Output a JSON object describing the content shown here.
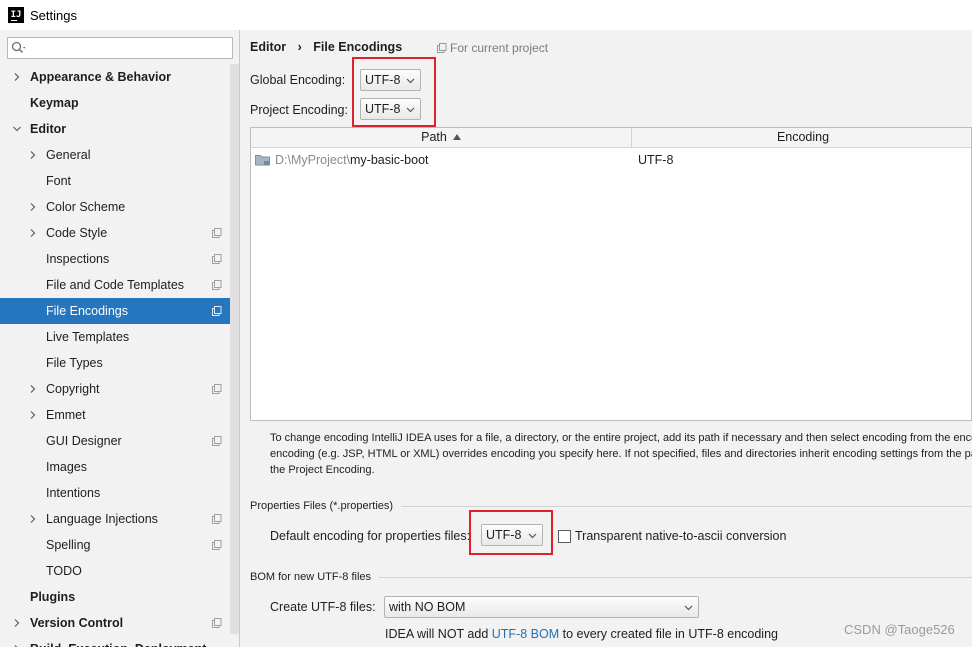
{
  "window": {
    "title": "Settings",
    "logo_text": "IJ"
  },
  "search": {
    "placeholder": ""
  },
  "sidebar": {
    "items": [
      {
        "label": "Appearance & Behavior",
        "level": 0,
        "bold": true,
        "expandable": true,
        "expanded": false,
        "project_icon": false,
        "selected": false
      },
      {
        "label": "Keymap",
        "level": 0,
        "bold": true,
        "expandable": false,
        "expanded": false,
        "project_icon": false,
        "selected": false
      },
      {
        "label": "Editor",
        "level": 0,
        "bold": true,
        "expandable": true,
        "expanded": true,
        "project_icon": false,
        "selected": false
      },
      {
        "label": "General",
        "level": 1,
        "bold": false,
        "expandable": true,
        "expanded": false,
        "project_icon": false,
        "selected": false
      },
      {
        "label": "Font",
        "level": 1,
        "bold": false,
        "expandable": false,
        "expanded": false,
        "project_icon": false,
        "selected": false
      },
      {
        "label": "Color Scheme",
        "level": 1,
        "bold": false,
        "expandable": true,
        "expanded": false,
        "project_icon": false,
        "selected": false
      },
      {
        "label": "Code Style",
        "level": 1,
        "bold": false,
        "expandable": true,
        "expanded": false,
        "project_icon": true,
        "selected": false
      },
      {
        "label": "Inspections",
        "level": 1,
        "bold": false,
        "expandable": false,
        "expanded": false,
        "project_icon": true,
        "selected": false
      },
      {
        "label": "File and Code Templates",
        "level": 1,
        "bold": false,
        "expandable": false,
        "expanded": false,
        "project_icon": true,
        "selected": false
      },
      {
        "label": "File Encodings",
        "level": 1,
        "bold": false,
        "expandable": false,
        "expanded": false,
        "project_icon": true,
        "selected": true
      },
      {
        "label": "Live Templates",
        "level": 1,
        "bold": false,
        "expandable": false,
        "expanded": false,
        "project_icon": false,
        "selected": false
      },
      {
        "label": "File Types",
        "level": 1,
        "bold": false,
        "expandable": false,
        "expanded": false,
        "project_icon": false,
        "selected": false
      },
      {
        "label": "Copyright",
        "level": 1,
        "bold": false,
        "expandable": true,
        "expanded": false,
        "project_icon": true,
        "selected": false
      },
      {
        "label": "Emmet",
        "level": 1,
        "bold": false,
        "expandable": true,
        "expanded": false,
        "project_icon": false,
        "selected": false
      },
      {
        "label": "GUI Designer",
        "level": 1,
        "bold": false,
        "expandable": false,
        "expanded": false,
        "project_icon": true,
        "selected": false
      },
      {
        "label": "Images",
        "level": 1,
        "bold": false,
        "expandable": false,
        "expanded": false,
        "project_icon": false,
        "selected": false
      },
      {
        "label": "Intentions",
        "level": 1,
        "bold": false,
        "expandable": false,
        "expanded": false,
        "project_icon": false,
        "selected": false
      },
      {
        "label": "Language Injections",
        "level": 1,
        "bold": false,
        "expandable": true,
        "expanded": false,
        "project_icon": true,
        "selected": false
      },
      {
        "label": "Spelling",
        "level": 1,
        "bold": false,
        "expandable": false,
        "expanded": false,
        "project_icon": true,
        "selected": false
      },
      {
        "label": "TODO",
        "level": 1,
        "bold": false,
        "expandable": false,
        "expanded": false,
        "project_icon": false,
        "selected": false
      },
      {
        "label": "Plugins",
        "level": 0,
        "bold": true,
        "expandable": false,
        "expanded": false,
        "project_icon": false,
        "selected": false
      },
      {
        "label": "Version Control",
        "level": 0,
        "bold": true,
        "expandable": true,
        "expanded": false,
        "project_icon": true,
        "selected": false
      },
      {
        "label": "Build, Execution, Deployment",
        "level": 0,
        "bold": true,
        "expandable": true,
        "expanded": false,
        "project_icon": false,
        "selected": false
      }
    ]
  },
  "breadcrumb": {
    "parent": "Editor",
    "separator": "›",
    "current": "File Encodings"
  },
  "scope_note": "For current project",
  "global_encoding": {
    "label": "Global Encoding:",
    "value": "UTF-8"
  },
  "project_encoding": {
    "label": "Project Encoding:",
    "value": "UTF-8"
  },
  "table": {
    "columns": {
      "path": "Path",
      "encoding": "Encoding"
    },
    "rows": [
      {
        "path_prefix": "D:\\MyProject\\",
        "path_name": "my-basic-boot",
        "encoding": "UTF-8"
      }
    ]
  },
  "help_text": [
    "To change encoding IntelliJ IDEA uses for a file, a directory, or the entire project, add its path if necessary and then select encoding from the enco",
    "encoding (e.g. JSP, HTML or XML) overrides encoding you specify here. If not specified, files and directories inherit encoding settings from the pa",
    "the Project Encoding."
  ],
  "properties": {
    "section_title": "Properties Files (*.properties)",
    "default_label": "Default encoding for properties files:",
    "default_value": "UTF-8",
    "transparent_label": "Transparent native-to-ascii conversion",
    "transparent_checked": false
  },
  "bom": {
    "section_title": "BOM for new UTF-8 files",
    "create_label": "Create UTF-8 files:",
    "create_value": "with NO BOM",
    "note_prefix": "IDEA will NOT add ",
    "note_link": "UTF-8 BOM",
    "note_suffix": " to every created file in UTF-8 encoding"
  },
  "watermark": "CSDN @Taoge526",
  "colors": {
    "selection": "#2675bf",
    "highlight_box": "#e0202d",
    "link": "#2470b3"
  }
}
